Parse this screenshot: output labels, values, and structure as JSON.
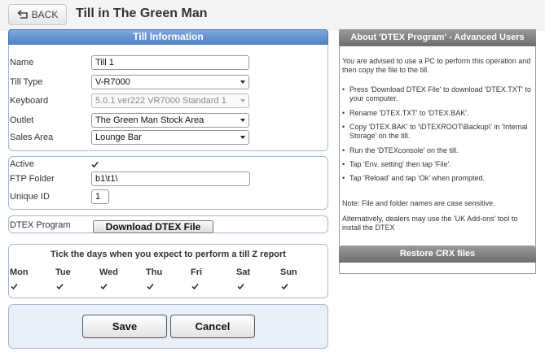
{
  "header": {
    "back_label": "BACK",
    "title": "Till in The Green Man"
  },
  "till_info": {
    "heading": "Till Information",
    "name_label": "Name",
    "name_value": "Till 1",
    "type_label": "Till Type",
    "type_value": "V-R7000",
    "keyboard_label": "Keyboard",
    "keyboard_value": "5.0.1 ver222 VR7000 Standard 1",
    "outlet_label": "Outlet",
    "outlet_value": "The Green Man Stock Area",
    "sales_area_label": "Sales Area",
    "sales_area_value": "Lounge Bar"
  },
  "settings": {
    "active_label": "Active",
    "active_checked": true,
    "ftp_label": "FTP Folder",
    "ftp_value": "b1\\t1\\",
    "unique_id_label": "Unique ID",
    "unique_id_value": "1"
  },
  "dtex": {
    "label": "DTEX Program",
    "download_label": "Download DTEX File"
  },
  "z_report": {
    "title": "Tick the days when you expect to perform a till Z report",
    "days": [
      {
        "label": "Mon",
        "checked": true
      },
      {
        "label": "Tue",
        "checked": true
      },
      {
        "label": "Wed",
        "checked": true
      },
      {
        "label": "Thu",
        "checked": true
      },
      {
        "label": "Fri",
        "checked": true
      },
      {
        "label": "Sat",
        "checked": true
      },
      {
        "label": "Sun",
        "checked": true
      }
    ]
  },
  "actions": {
    "save_label": "Save",
    "cancel_label": "Cancel"
  },
  "info_panel": {
    "heading": "About 'DTEX Program' - Advanced Users",
    "intro": "You are advised to use a PC to perform this operation and then copy the file to the till.",
    "steps": [
      "Press 'Download DTEX File' to download 'DTEX.TXT' to your computer.",
      "Rename 'DTEX.TXT' to 'DTEX.BAK'.",
      "Copy 'DTEX.BAK' to '\\DTEXROOT\\Backup\\' in 'Internal Storage' on the till.",
      "Run the 'DTEXconsole' on the till.",
      "Tap 'Env. setting' then tap 'File'.",
      "Tap 'Reload' and tap 'Ok' when prompted."
    ],
    "note": "Note: File and folder names are case sensitive.",
    "dealer_note": "Alternatively, dealers may use the 'UK Add-ons' tool to install the DTEX",
    "restore_label": "Restore CRX files"
  },
  "icons": {
    "back": "return-arrow-icon",
    "checkbox": "checkmark-icon",
    "dropdown": "chevron-down-icon"
  }
}
